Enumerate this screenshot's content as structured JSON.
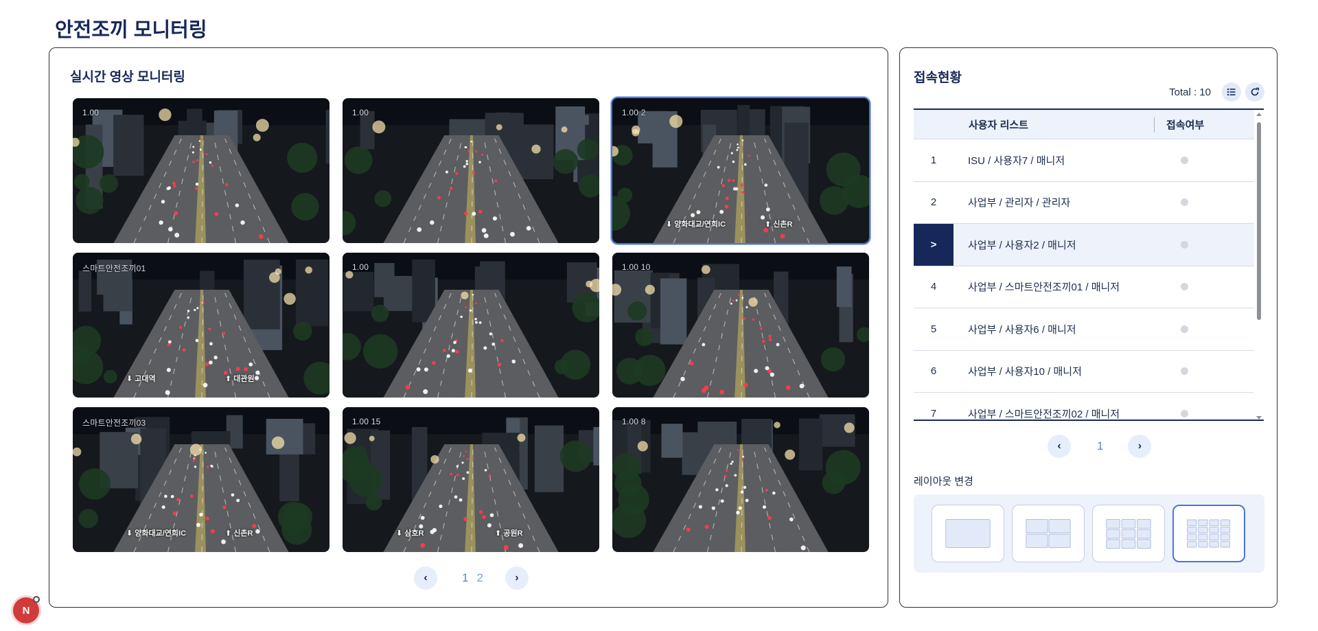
{
  "page": {
    "title": "안전조끼 모니터링"
  },
  "monitor": {
    "title": "실시간 영상 모니터링",
    "cameras": [
      {
        "label": "1.00",
        "signs": []
      },
      {
        "label": "1.00",
        "signs": []
      },
      {
        "label": "1.00 2",
        "signs": [
          "⬇ 양화대교/연희IC",
          "⬆ 신촌R"
        ]
      },
      {
        "label": "스마트안전조끼01",
        "signs": [
          "⬇ 고대역",
          "⬆ 대관원"
        ]
      },
      {
        "label": "1.00",
        "signs": []
      },
      {
        "label": "1.00 10",
        "signs": []
      },
      {
        "label": "스마트안전조끼03",
        "signs": [
          "⬇ 양화대교/연희IC",
          "⬆ 신촌R"
        ]
      },
      {
        "label": "1.00 15",
        "signs": [
          "⬇ 삼호R",
          "⬆ 공원R"
        ]
      },
      {
        "label": "1.00 8",
        "signs": []
      }
    ],
    "pager": {
      "pages": [
        "1",
        "2"
      ],
      "current": "1"
    }
  },
  "connections": {
    "title": "접속현황",
    "total": "Total : 10",
    "headers": {
      "name": "사용자 리스트",
      "status": "접속여부"
    },
    "rows": [
      {
        "no": "1",
        "name": "ISU / 사용자7 / 매니저"
      },
      {
        "no": "2",
        "name": "사업부 / 관리자 / 관리자"
      },
      {
        "no": ">",
        "name": "사업부 / 사용자2 / 매니저"
      },
      {
        "no": "4",
        "name": "사업부 / 스마트안전조끼01 / 매니저"
      },
      {
        "no": "5",
        "name": "사업부 / 사용자6 / 매니저"
      },
      {
        "no": "6",
        "name": "사업부 / 사용자10 / 매니저"
      },
      {
        "no": "7",
        "name": "사업부 / 스마트안전조끼02 / 매니저"
      }
    ],
    "selected_row": 2,
    "pager": {
      "pages": [
        "1"
      ],
      "current": "1"
    }
  },
  "layout": {
    "label": "레이아웃 변경",
    "options": [
      "1x1",
      "2x2",
      "3x3",
      "4x4"
    ],
    "selected": "4x4"
  },
  "floating_badge": {
    "text": "N"
  },
  "colors": {
    "navy": "#16285a",
    "accent": "#4a74d8",
    "panel_bg": "#edf2fb"
  }
}
